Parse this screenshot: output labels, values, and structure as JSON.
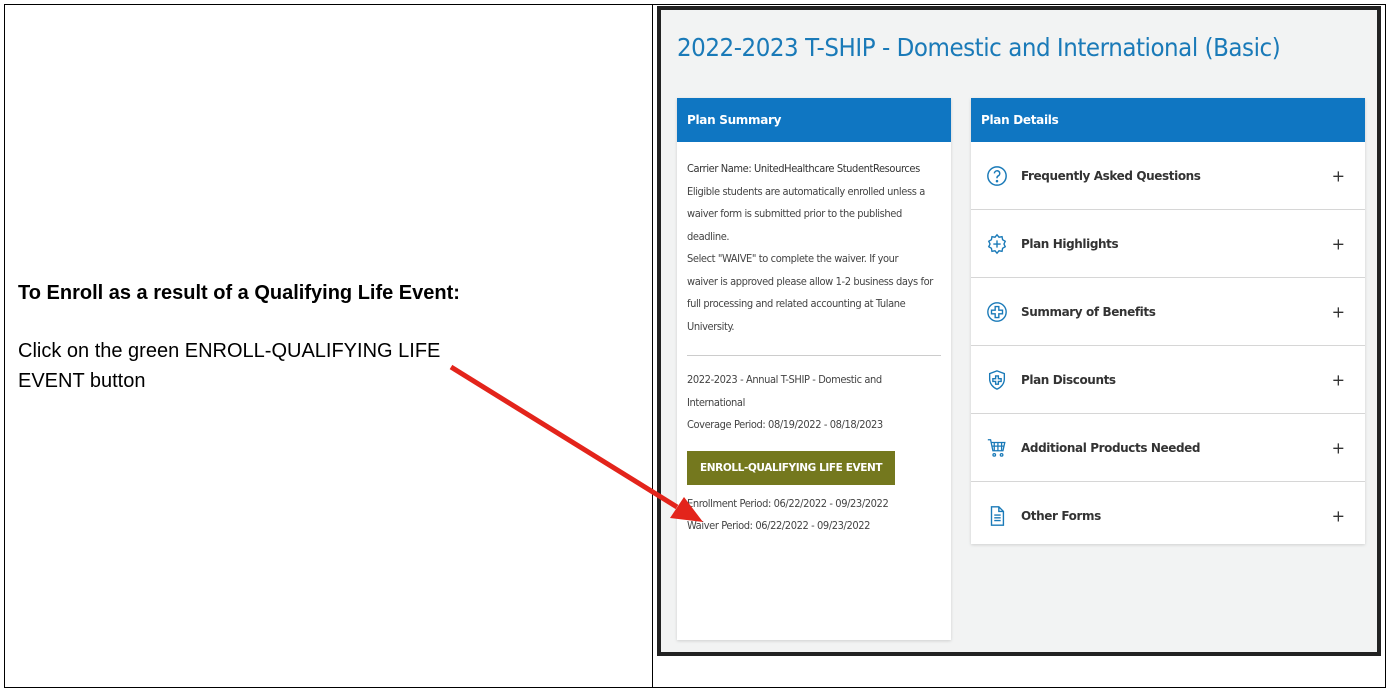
{
  "instructions": {
    "heading": "To Enroll as a result of a Qualifying Life Event:",
    "body": "Click on the green ENROLL-QUALIFYING LIFE EVENT button"
  },
  "plan": {
    "title": "2022-2023 T-SHIP - Domestic and International (Basic)"
  },
  "summary": {
    "header": "Plan Summary",
    "carrier": "Carrier Name: UnitedHealthcare StudentResources",
    "line1": "Eligible students are automatically enrolled unless a",
    "line2": "waiver form is submitted prior to the published",
    "line3": "deadline.",
    "line4": "Select \"WAIVE\" to complete the waiver. If your",
    "line5": "waiver is approved please allow 1-2 business days for",
    "line6": "full processing and related accounting at Tulane",
    "line7": "University.",
    "plan_name_1": "2022-2023 - Annual T-SHIP - Domestic and",
    "plan_name_2": "International",
    "coverage": "Coverage Period: 08/19/2022 - 08/18/2023",
    "enroll_button": "ENROLL-QUALIFYING LIFE EVENT",
    "enrollment_period": "Enrollment Period: 06/22/2022 - 09/23/2022",
    "waiver_period": "Waiver Period: 06/22/2022 - 09/23/2022"
  },
  "details": {
    "header": "Plan Details",
    "items": [
      {
        "label": "Frequently Asked Questions",
        "icon": "question-circle-icon"
      },
      {
        "label": "Plan Highlights",
        "icon": "medical-badge-icon"
      },
      {
        "label": "Summary of Benefits",
        "icon": "plus-circle-icon"
      },
      {
        "label": "Plan Discounts",
        "icon": "shield-plus-icon"
      },
      {
        "label": "Additional Products Needed",
        "icon": "cart-icon"
      },
      {
        "label": "Other Forms",
        "icon": "document-icon"
      }
    ],
    "expand_symbol": "+"
  },
  "colors": {
    "accent_blue": "#0f76c2",
    "title_blue": "#1a7ab8",
    "enroll_green": "#74781e",
    "arrow_red": "#e3241b"
  }
}
